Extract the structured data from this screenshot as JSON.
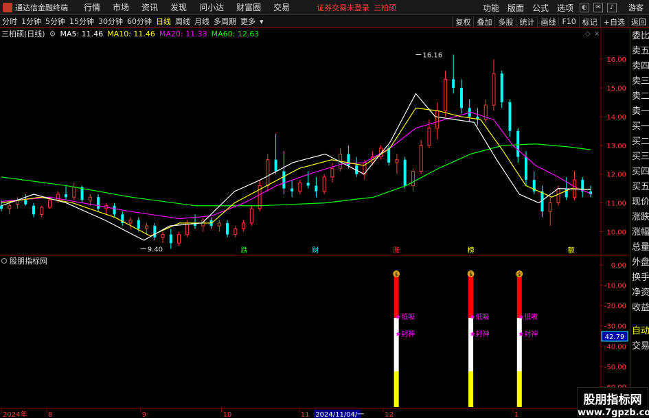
{
  "menubar": {
    "app_title": "通达信金融终端",
    "items": [
      "行情",
      "市场",
      "资讯",
      "发现",
      "问小达",
      "财富圈",
      "交易"
    ],
    "notice": "证券交易未登录",
    "stock_name": "三柏硕",
    "right_items": [
      "功能",
      "版面",
      "公式",
      "选项"
    ],
    "guest": "游客"
  },
  "toolbar": {
    "periods": [
      "分时",
      "1分钟",
      "5分钟",
      "15分钟",
      "30分钟",
      "60分钟",
      "日线",
      "周线",
      "月线",
      "多周期",
      "更多"
    ],
    "active_period": "日线",
    "right_buttons": [
      "复权",
      "叠加",
      "多股",
      "统计",
      "画线",
      "F10",
      "标记",
      "+自选",
      "返回"
    ]
  },
  "info": {
    "stock": "三柏硕(日线)",
    "ma5_label": "MA5: 11.46",
    "ma10_label": "MA10: 11.46",
    "ma20_label": "MA20: 11.33",
    "ma60_label": "MA60: 12.63",
    "colors": {
      "ma5": "#ffffff",
      "ma10": "#ffff00",
      "ma20": "#ff00ff",
      "ma60": "#00ff00"
    }
  },
  "sidebar": {
    "items": [
      "委比",
      "卖五",
      "卖四",
      "卖三",
      "卖二",
      "卖一",
      "买一",
      "买二",
      "买三",
      "买四",
      "买五",
      "现价",
      "涨跌",
      "涨幅",
      "总量",
      "外盘",
      "换手",
      "净资",
      "收益"
    ],
    "lower_items": [
      "自动",
      "交易"
    ]
  },
  "chart_data": [
    {
      "type": "candlestick",
      "title": "三柏硕(日线)",
      "ylim": [
        9.2,
        16.6
      ],
      "yticks": [
        "16.00",
        "15.00",
        "14.00",
        "13.00",
        "12.00",
        "11.00",
        "10.00"
      ],
      "ytick_values": [
        16,
        15,
        14,
        13,
        12,
        11,
        10
      ],
      "annotations": [
        {
          "label": "16.16",
          "value": 16.16,
          "index": 128
        },
        {
          "label": "9.40",
          "value": 9.4,
          "index": 43
        }
      ],
      "markers": [
        {
          "label": "跌",
          "index": 75,
          "color": "#00ff00"
        },
        {
          "label": "财",
          "index": 97,
          "color": "#00ffff"
        },
        {
          "label": "涨",
          "index": 122,
          "color": "#ff3b3b"
        },
        {
          "label": "榜",
          "index": 145,
          "color": "#ffff00"
        },
        {
          "label": "额",
          "index": 176,
          "color": "#ffff00"
        }
      ],
      "ma_series": [
        {
          "name": "MA60",
          "color": "#00ff00",
          "points": [
            [
              0,
              11.9
            ],
            [
              20,
              11.6
            ],
            [
              40,
              11.2
            ],
            [
              60,
              10.9
            ],
            [
              80,
              10.9
            ],
            [
              100,
              11.0
            ],
            [
              115,
              11.2
            ],
            [
              125,
              11.6
            ],
            [
              135,
              12.2
            ],
            [
              145,
              12.7
            ],
            [
              155,
              13.0
            ],
            [
              165,
              13.05
            ],
            [
              175,
              12.95
            ],
            [
              182,
              12.85
            ]
          ]
        },
        {
          "name": "MA20",
          "color": "#ff00ff",
          "points": [
            [
              0,
              11.05
            ],
            [
              15,
              11.2
            ],
            [
              25,
              11.0
            ],
            [
              40,
              10.7
            ],
            [
              55,
              10.45
            ],
            [
              65,
              10.55
            ],
            [
              75,
              11.0
            ],
            [
              85,
              11.6
            ],
            [
              95,
              12.0
            ],
            [
              105,
              12.35
            ],
            [
              112,
              12.4
            ],
            [
              120,
              12.9
            ],
            [
              128,
              13.6
            ],
            [
              137,
              13.9
            ],
            [
              145,
              14.15
            ],
            [
              152,
              13.9
            ],
            [
              158,
              13.0
            ],
            [
              165,
              12.3
            ],
            [
              172,
              11.9
            ],
            [
              178,
              11.5
            ],
            [
              182,
              11.33
            ]
          ]
        },
        {
          "name": "MA10",
          "color": "#ffff00",
          "points": [
            [
              0,
              11.0
            ],
            [
              12,
              11.2
            ],
            [
              22,
              11.0
            ],
            [
              35,
              10.5
            ],
            [
              46,
              9.85
            ],
            [
              55,
              10.3
            ],
            [
              65,
              10.3
            ],
            [
              72,
              11.0
            ],
            [
              82,
              11.6
            ],
            [
              92,
              12.2
            ],
            [
              102,
              12.5
            ],
            [
              112,
              12.3
            ],
            [
              120,
              12.9
            ],
            [
              128,
              14.3
            ],
            [
              135,
              14.2
            ],
            [
              142,
              14.0
            ],
            [
              148,
              13.9
            ],
            [
              155,
              12.8
            ],
            [
              162,
              11.6
            ],
            [
              170,
              11.2
            ],
            [
              176,
              11.5
            ],
            [
              182,
              11.46
            ]
          ]
        },
        {
          "name": "MA5",
          "color": "#ffffff",
          "points": [
            [
              0,
              10.9
            ],
            [
              10,
              11.3
            ],
            [
              20,
              11.0
            ],
            [
              32,
              10.4
            ],
            [
              44,
              9.7
            ],
            [
              52,
              10.2
            ],
            [
              62,
              10.3
            ],
            [
              72,
              11.4
            ],
            [
              80,
              11.8
            ],
            [
              90,
              12.4
            ],
            [
              100,
              12.7
            ],
            [
              112,
              12.0
            ],
            [
              120,
              13.1
            ],
            [
              128,
              14.8
            ],
            [
              134,
              14.0
            ],
            [
              140,
              13.9
            ],
            [
              146,
              13.8
            ],
            [
              153,
              12.5
            ],
            [
              160,
              11.3
            ],
            [
              166,
              11.0
            ],
            [
              172,
              11.5
            ],
            [
              182,
              11.46
            ]
          ]
        }
      ],
      "candles": [
        [
          0,
          10.9,
          11.1,
          10.7,
          10.8
        ],
        [
          1,
          10.8,
          11.0,
          10.6,
          10.9
        ],
        [
          2,
          10.95,
          11.2,
          10.8,
          11.1
        ],
        [
          3,
          11.1,
          11.3,
          10.9,
          10.95
        ],
        [
          4,
          10.9,
          11.0,
          10.5,
          10.6
        ],
        [
          5,
          10.6,
          10.9,
          10.5,
          10.85
        ],
        [
          6,
          10.85,
          11.2,
          10.8,
          11.1
        ],
        [
          7,
          11.1,
          11.4,
          11.0,
          11.3
        ],
        [
          8,
          11.3,
          11.6,
          11.1,
          11.2
        ],
        [
          9,
          11.2,
          11.7,
          11.1,
          11.55
        ],
        [
          10,
          11.55,
          11.6,
          11.0,
          11.1
        ],
        [
          11,
          11.1,
          11.3,
          10.9,
          11.2
        ],
        [
          12,
          11.2,
          11.3,
          10.7,
          10.8
        ],
        [
          13,
          10.8,
          11.0,
          10.6,
          10.9
        ],
        [
          14,
          10.9,
          11.0,
          10.5,
          10.6
        ],
        [
          15,
          10.6,
          10.7,
          10.2,
          10.3
        ],
        [
          16,
          10.3,
          10.5,
          10.1,
          10.4
        ],
        [
          17,
          10.4,
          10.5,
          10.0,
          10.1
        ],
        [
          18,
          10.1,
          10.3,
          9.9,
          10.2
        ],
        [
          19,
          10.2,
          10.3,
          9.7,
          9.8
        ],
        [
          20,
          9.8,
          10.0,
          9.6,
          9.9
        ],
        [
          21,
          9.9,
          10.1,
          9.4,
          9.6
        ],
        [
          22,
          9.6,
          10.0,
          9.5,
          9.9
        ],
        [
          23,
          9.9,
          10.4,
          9.8,
          10.3
        ],
        [
          24,
          10.3,
          10.6,
          10.1,
          10.2
        ],
        [
          25,
          10.2,
          10.5,
          10.0,
          10.4
        ],
        [
          26,
          10.4,
          10.5,
          10.1,
          10.2
        ],
        [
          27,
          10.2,
          10.4,
          10.0,
          10.3
        ],
        [
          28,
          10.3,
          10.4,
          9.8,
          9.9
        ],
        [
          29,
          9.9,
          10.2,
          9.8,
          10.1
        ],
        [
          30,
          10.1,
          10.4,
          10.0,
          10.3
        ],
        [
          31,
          10.3,
          10.9,
          10.2,
          10.8
        ],
        [
          32,
          10.8,
          11.8,
          10.7,
          11.6
        ],
        [
          33,
          11.6,
          12.7,
          11.4,
          12.5
        ],
        [
          34,
          12.5,
          13.4,
          12.0,
          12.1
        ],
        [
          35,
          12.1,
          12.8,
          11.3,
          11.5
        ],
        [
          36,
          11.5,
          11.8,
          11.2,
          11.4
        ],
        [
          37,
          11.4,
          11.8,
          11.3,
          11.7
        ],
        [
          38,
          11.7,
          12.1,
          11.5,
          11.6
        ],
        [
          39,
          11.6,
          11.9,
          11.2,
          11.4
        ],
        [
          40,
          11.4,
          12.0,
          11.3,
          11.9
        ],
        [
          41,
          11.9,
          12.4,
          11.7,
          12.2
        ],
        [
          42,
          12.2,
          12.9,
          12.1,
          12.7
        ],
        [
          43,
          12.7,
          13.0,
          12.2,
          12.3
        ],
        [
          44,
          12.3,
          12.6,
          11.9,
          12.0
        ],
        [
          45,
          12.0,
          12.5,
          11.8,
          12.4
        ],
        [
          46,
          12.4,
          12.8,
          12.3,
          12.6
        ],
        [
          47,
          12.6,
          13.0,
          12.5,
          12.9
        ],
        [
          48,
          12.9,
          13.0,
          12.3,
          12.4
        ],
        [
          49,
          12.4,
          12.7,
          12.0,
          12.5
        ],
        [
          50,
          12.5,
          12.6,
          11.5,
          11.6
        ],
        [
          51,
          11.6,
          12.2,
          11.4,
          12.1
        ],
        [
          52,
          12.1,
          13.2,
          12.0,
          13.0
        ],
        [
          53,
          13.0,
          13.9,
          12.9,
          13.6
        ],
        [
          54,
          13.6,
          14.5,
          13.2,
          14.2
        ],
        [
          55,
          14.2,
          15.6,
          14.0,
          15.3
        ],
        [
          56,
          15.3,
          16.16,
          14.8,
          15.0
        ],
        [
          57,
          15.0,
          15.3,
          14.1,
          14.3
        ],
        [
          58,
          14.3,
          14.6,
          13.8,
          14.0
        ],
        [
          59,
          14.0,
          14.3,
          13.7,
          13.9
        ],
        [
          60,
          13.9,
          14.6,
          13.8,
          14.4
        ],
        [
          61,
          14.4,
          16.0,
          14.2,
          15.5
        ],
        [
          62,
          15.5,
          15.6,
          14.3,
          14.5
        ],
        [
          63,
          14.5,
          14.6,
          13.3,
          13.5
        ],
        [
          64,
          13.5,
          13.6,
          12.4,
          12.6
        ],
        [
          65,
          12.6,
          12.8,
          11.6,
          11.8
        ],
        [
          66,
          11.8,
          12.1,
          11.3,
          11.4
        ],
        [
          67,
          11.4,
          11.6,
          10.5,
          10.7
        ],
        [
          68,
          10.7,
          11.2,
          10.2,
          11.0
        ],
        [
          69,
          11.0,
          11.6,
          10.9,
          11.5
        ],
        [
          70,
          11.5,
          11.9,
          11.1,
          11.2
        ],
        [
          71,
          11.2,
          12.1,
          11.1,
          11.8
        ],
        [
          72,
          11.8,
          11.9,
          11.2,
          11.4
        ],
        [
          73,
          11.4,
          11.6,
          11.2,
          11.3
        ]
      ]
    },
    {
      "type": "bar",
      "title": "股朋指标网",
      "ylim": [
        -70,
        0
      ],
      "yticks": [
        "0.00",
        "-10.00",
        "-20.00",
        "-30.00",
        "-40.00",
        "-50.00",
        "-60.00"
      ],
      "ytick_values": [
        0,
        -10,
        -20,
        -30,
        -40,
        -50,
        -60
      ],
      "current_value_label": "42.79",
      "signals": [
        {
          "index": 122,
          "labels": [
            "★低吸",
            "★封神"
          ]
        },
        {
          "index": 145,
          "labels": [
            "★低吸",
            "★封神"
          ]
        },
        {
          "index": 160,
          "labels": [
            "★低吸",
            "★封神"
          ]
        }
      ],
      "segment_colors": [
        "#ff0000",
        "#ffffff",
        "#ffff00"
      ]
    }
  ],
  "time_axis": {
    "labels": [
      "2024年",
      "8",
      "9",
      "10",
      "11",
      "2024/11/04/一",
      "12",
      "1"
    ],
    "positions": [
      0,
      14,
      43,
      68,
      92,
      97,
      118,
      158
    ]
  },
  "watermark": {
    "title": "股朋指标网",
    "url": "www.7gpzb.com"
  }
}
